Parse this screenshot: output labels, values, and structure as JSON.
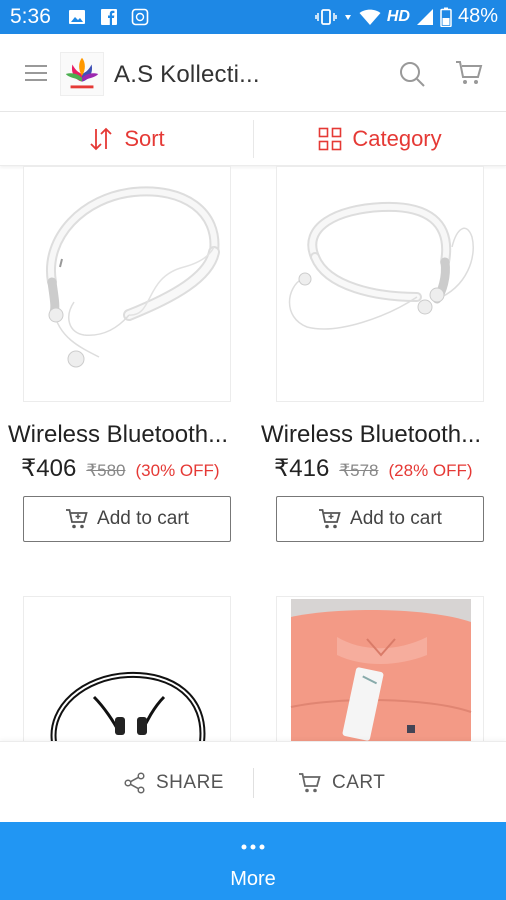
{
  "status_bar": {
    "time": "5:36",
    "network_label": "HD",
    "battery": "48%",
    "bg_color": "#1e88e5"
  },
  "app_bar": {
    "title": "A.S Kollecti...",
    "icons": [
      "menu-icon",
      "store-logo",
      "search-icon",
      "cart-icon"
    ]
  },
  "filters": {
    "sort_label": "Sort",
    "category_label": "Category",
    "accent_color": "#e53935"
  },
  "products": [
    {
      "title": "Wireless Bluetooth...",
      "price": "₹406",
      "mrp": "₹580",
      "discount": "(30% OFF)",
      "add_to_cart_label": "Add to cart"
    },
    {
      "title": "Wireless Bluetooth...",
      "price": "₹416",
      "mrp": "₹578",
      "discount": "(28% OFF)",
      "add_to_cart_label": "Add to cart"
    },
    {
      "title": "",
      "image": "earphones-drawing"
    },
    {
      "title": "",
      "image": "pink-shirt"
    }
  ],
  "action_bar": {
    "share_label": "SHARE",
    "cart_label": "CART"
  },
  "more_bar": {
    "label": "More",
    "bg_color": "#2196f3"
  }
}
